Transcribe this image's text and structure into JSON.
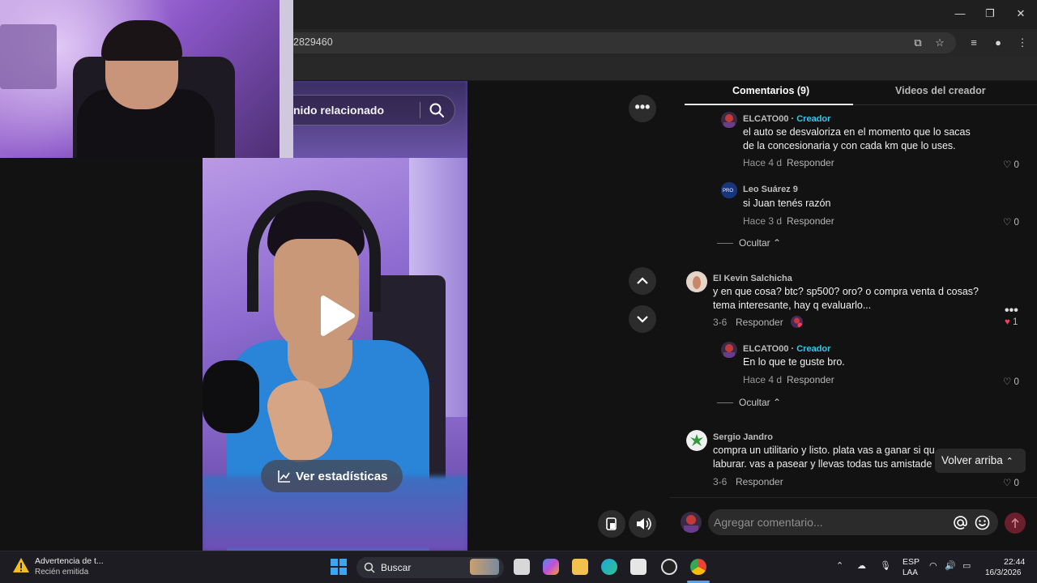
{
  "browser": {
    "address_fragment": "2829460"
  },
  "video": {
    "search_text": "nido relacionado",
    "stats_label": "Ver estadísticas"
  },
  "comments": {
    "tab_comments": "Comentarios (9)",
    "tab_creator_videos": "Videos del creador",
    "items": [
      {
        "user": "ELCATO00",
        "badge": "Creador",
        "text1": "el auto se desvaloriza en el momento que lo sacas",
        "text2": "de la concesionaria y con cada km que lo uses.",
        "time": "Hace 4 d",
        "reply": "Responder",
        "likes": "0"
      },
      {
        "user": "Leo Suárez 9",
        "text1": "si Juan tenés razón",
        "time": "Hace 3 d",
        "reply": "Responder",
        "likes": "0"
      },
      {
        "hide": "Ocultar"
      },
      {
        "user": "El Kevin Salchicha",
        "text1": "y en que cosa? btc? sp500? oro? o compra venta d cosas?",
        "text2": "tema interesante, hay q evaluarlo...",
        "time": "3-6",
        "reply": "Responder",
        "likes": "1"
      },
      {
        "user": "ELCATO00",
        "badge": "Creador",
        "text1": "En lo que te guste bro.",
        "time": "Hace 4 d",
        "reply": "Responder",
        "likes": "0"
      },
      {
        "hide": "Ocultar"
      },
      {
        "user": "Sergio Jandro",
        "text1": "compra un utilitario y listo. plata vas a ganar si qu",
        "text2": "laburar. vas a pasear y llevas todas tus amistade",
        "time": "3-6",
        "reply": "Responder",
        "likes": "0"
      }
    ],
    "back_to_top": "Volver arriba",
    "add_placeholder": "Agregar comentario..."
  },
  "taskbar": {
    "notif_title": "Advertencia de t...",
    "notif_sub": "Recién emitida",
    "search": "Buscar",
    "lang1": "ESP",
    "lang2": "LAA",
    "time": "22:44",
    "date": "16/3/2026"
  },
  "colors": {
    "creator_accent": "#35c8e8",
    "like_active": "#ff3b5c"
  }
}
